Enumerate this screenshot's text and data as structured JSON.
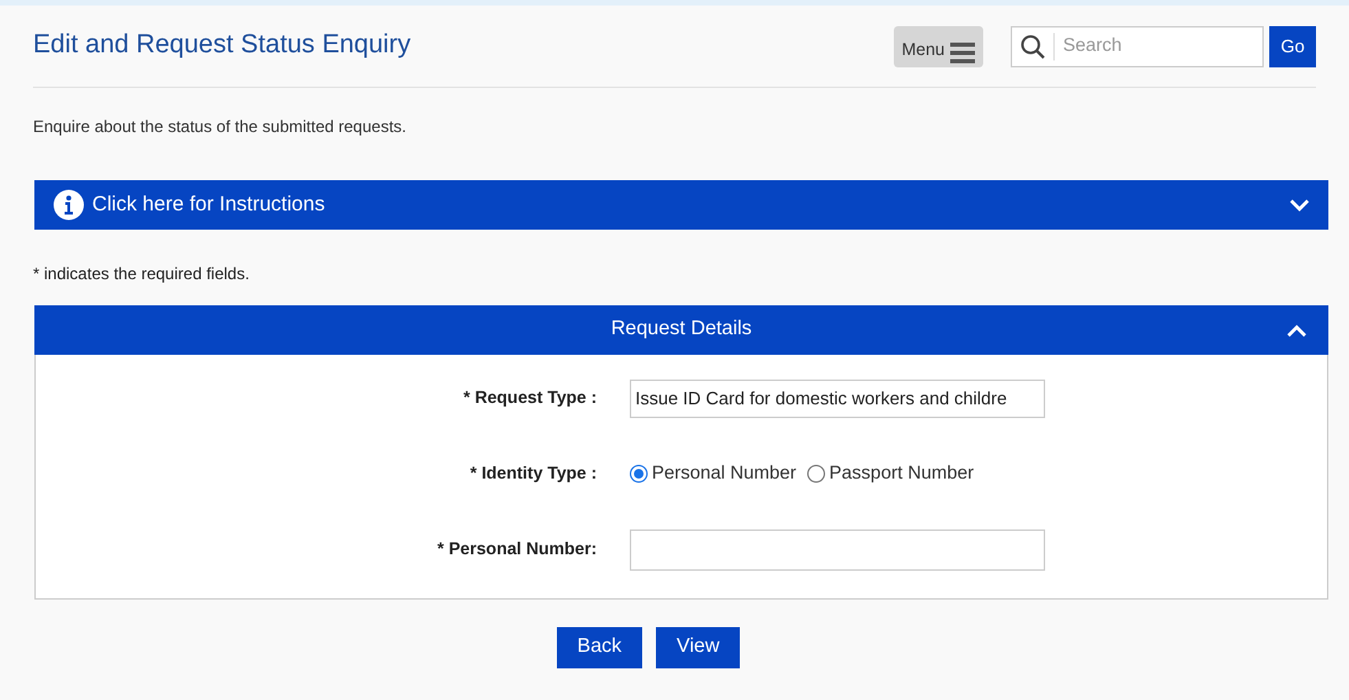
{
  "header": {
    "title": "Edit and Request Status Enquiry",
    "menu_label": "Menu",
    "search": {
      "placeholder": "Search"
    },
    "go_label": "Go"
  },
  "description": "Enquire about the status of the submitted requests.",
  "instructions": {
    "label": "Click here for Instructions",
    "expanded": false
  },
  "required_note": "* indicates the required fields.",
  "request_details": {
    "title": "Request Details",
    "expanded": true,
    "fields": [
      {
        "kind": "select",
        "label": "* Request Type :",
        "value": "Issue ID Card for domestic workers and childre"
      },
      {
        "kind": "radio",
        "label": "* Identity Type :",
        "options": [
          {
            "label": "Personal Number",
            "selected": true
          },
          {
            "label": "Passport Number",
            "selected": false
          }
        ]
      },
      {
        "kind": "text",
        "label": "* Personal Number:"
      }
    ]
  },
  "buttons": [
    "Back",
    "View"
  ]
}
